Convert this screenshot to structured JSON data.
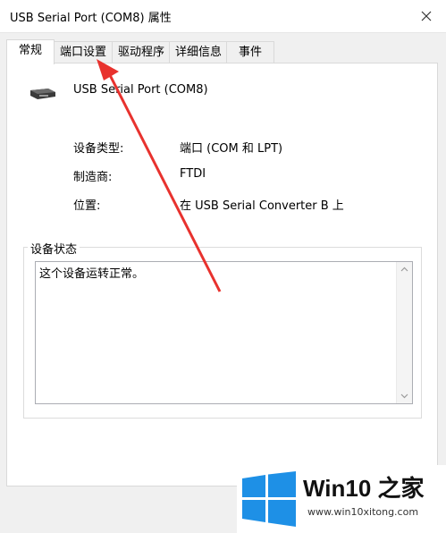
{
  "window": {
    "title": "USB Serial Port (COM8) 属性"
  },
  "tabs": [
    {
      "label": "常规",
      "active": true
    },
    {
      "label": "端口设置",
      "active": false
    },
    {
      "label": "驱动程序",
      "active": false
    },
    {
      "label": "详细信息",
      "active": false
    },
    {
      "label": "事件",
      "active": false
    }
  ],
  "device": {
    "name": "USB Serial Port (COM8)",
    "icon": "serial-port-device-icon"
  },
  "properties": [
    {
      "label": "设备类型:",
      "value": "端口 (COM 和 LPT)"
    },
    {
      "label": "制造商:",
      "value": "FTDI"
    },
    {
      "label": "位置:",
      "value": "在 USB Serial Converter B 上"
    }
  ],
  "status_group": {
    "title": "设备状态",
    "text": "这个设备运转正常。"
  },
  "watermark": {
    "brand": "Win10 之家",
    "url": "www.win10xitong.com",
    "logo_color": "#1e90e6"
  },
  "annotation": {
    "arrow_color": "#e8322e"
  }
}
